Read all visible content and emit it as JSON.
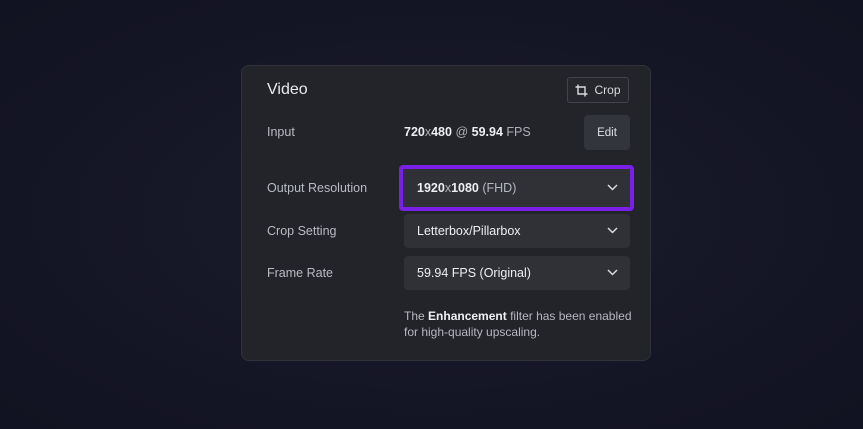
{
  "panel": {
    "title": "Video",
    "crop_button": {
      "label": "Crop",
      "icon": "crop-icon"
    },
    "edit_button": {
      "label": "Edit"
    },
    "rows": {
      "input": {
        "label": "Input",
        "width": "720",
        "sep": "x",
        "height": "480",
        "at": "@",
        "fps": "59.94",
        "fps_unit": "FPS"
      },
      "output_resolution": {
        "label": "Output Resolution",
        "value_main": "1920",
        "value_sep": "x",
        "value_second": "1080",
        "value_suffix": "(FHD)"
      },
      "crop_setting": {
        "label": "Crop Setting",
        "value": "Letterbox/Pillarbox"
      },
      "frame_rate": {
        "label": "Frame Rate",
        "value": "59.94 FPS (Original)"
      }
    },
    "note": {
      "prefix": "The",
      "bold": "Enhancement",
      "suffix": "filter has been enabled for high-quality upscaling."
    }
  },
  "colors": {
    "background": "#161726",
    "panel": "#222429",
    "highlight": "#7a1fe8"
  }
}
